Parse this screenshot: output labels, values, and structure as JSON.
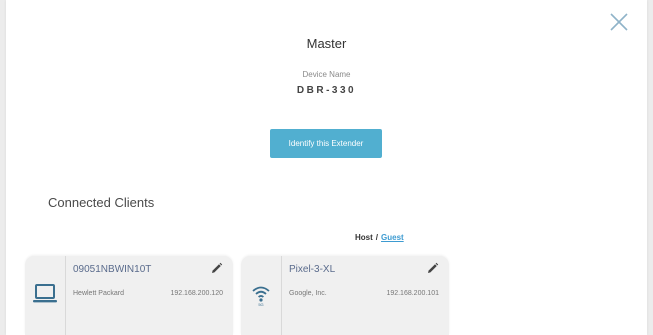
{
  "panel": {
    "role": "Master",
    "device_name_label": "Device Name",
    "device_name": "DBR-330",
    "identify_button": "Identify this Extender",
    "close_icon": "close-icon"
  },
  "clients": {
    "title": "Connected Clients",
    "filter": {
      "host": "Host",
      "separator": "/",
      "guest": "Guest"
    },
    "items": [
      {
        "name": "09051NBWIN10T",
        "vendor": "Hewlett Packard",
        "ip": "192.168.200.120",
        "icon": "laptop-icon"
      },
      {
        "name": "Pixel-3-XL",
        "vendor": "Google, Inc.",
        "ip": "192.168.200.101",
        "icon": "wifi-icon"
      }
    ]
  },
  "colors": {
    "accent_button": "#51afd0",
    "link": "#3d9bd1",
    "client_name": "#5a6b8c",
    "close_icon": "#8fb3c9"
  }
}
